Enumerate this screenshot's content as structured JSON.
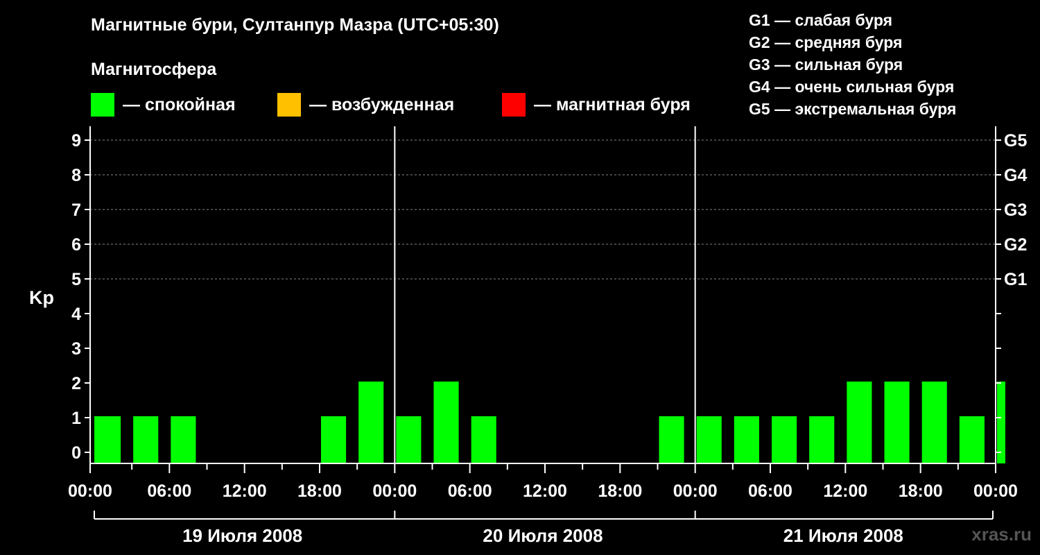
{
  "title": "Магнитные бури, Султанпур Мазра (UTC+05:30)",
  "subtitle": "Магнитосфера",
  "legend": [
    {
      "label": "— спокойная",
      "color": "#00ff00"
    },
    {
      "label": "— возбужденная",
      "color": "#ffc000"
    },
    {
      "label": "— магнитная буря",
      "color": "#ff0000"
    }
  ],
  "g_scale": [
    "G1 — слабая буря",
    "G2 — средняя буря",
    "G3 — сильная буря",
    "G4 — очень сильная буря",
    "G5 — экстремальная буря"
  ],
  "watermark": "xras.ru",
  "chart_data": {
    "type": "bar",
    "ylabel": "Kp",
    "ylim": [
      0,
      9
    ],
    "yticks": [
      "0",
      "1",
      "2",
      "3",
      "4",
      "5",
      "6",
      "7",
      "8",
      "9"
    ],
    "right_ticks": [
      "G1",
      "G2",
      "G3",
      "G4",
      "G5"
    ],
    "xticks": [
      "00:00",
      "06:00",
      "12:00",
      "18:00",
      "00:00",
      "06:00",
      "12:00",
      "18:00",
      "00:00",
      "06:00",
      "12:00",
      "18:00",
      "00:00"
    ],
    "days": [
      "19 Июля 2008",
      "20 Июля 2008",
      "21 Июля 2008"
    ],
    "grid": true,
    "colors": {
      "quiet": "#00ff00",
      "active": "#ffc000",
      "storm": "#ff0000"
    },
    "bars": [
      {
        "start_hour": 0,
        "end_hour": 2,
        "value": 1
      },
      {
        "start_hour": 3,
        "end_hour": 5,
        "value": 1
      },
      {
        "start_hour": 6,
        "end_hour": 8,
        "value": 1
      },
      {
        "start_hour": 9,
        "end_hour": 11,
        "value": 0
      },
      {
        "start_hour": 12,
        "end_hour": 14,
        "value": 0
      },
      {
        "start_hour": 15,
        "end_hour": 17,
        "value": 0
      },
      {
        "start_hour": 18,
        "end_hour": 20,
        "value": 1
      },
      {
        "start_hour": 21,
        "end_hour": 23,
        "value": 2
      },
      {
        "start_hour": 24,
        "end_hour": 26,
        "value": 1
      },
      {
        "start_hour": 27,
        "end_hour": 29,
        "value": 2
      },
      {
        "start_hour": 30,
        "end_hour": 32,
        "value": 1
      },
      {
        "start_hour": 33,
        "end_hour": 35,
        "value": 0
      },
      {
        "start_hour": 36,
        "end_hour": 38,
        "value": 0
      },
      {
        "start_hour": 39,
        "end_hour": 41,
        "value": 0
      },
      {
        "start_hour": 42,
        "end_hour": 44,
        "value": 0
      },
      {
        "start_hour": 45,
        "end_hour": 47,
        "value": 1
      },
      {
        "start_hour": 48,
        "end_hour": 50,
        "value": 1
      },
      {
        "start_hour": 51,
        "end_hour": 53,
        "value": 1
      },
      {
        "start_hour": 54,
        "end_hour": 56,
        "value": 1
      },
      {
        "start_hour": 57,
        "end_hour": 59,
        "value": 1
      },
      {
        "start_hour": 60,
        "end_hour": 62,
        "value": 2
      },
      {
        "start_hour": 63,
        "end_hour": 65,
        "value": 2
      },
      {
        "start_hour": 66,
        "end_hour": 68,
        "value": 2
      },
      {
        "start_hour": 69,
        "end_hour": 71,
        "value": 1
      },
      {
        "start_hour": 72,
        "end_hour": 72,
        "value": 2
      }
    ]
  }
}
